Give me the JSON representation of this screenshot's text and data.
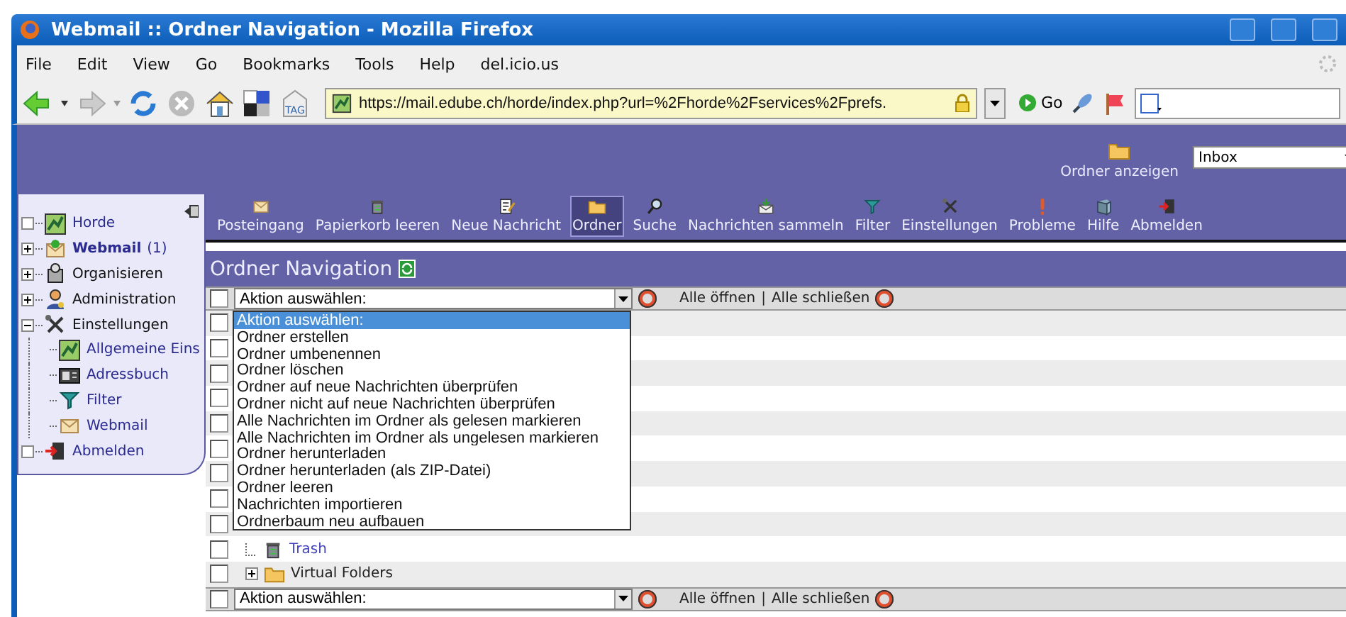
{
  "window": {
    "title": "Webmail :: Ordner Navigation - Mozilla Firefox"
  },
  "menu": [
    "File",
    "Edit",
    "View",
    "Go",
    "Bookmarks",
    "Tools",
    "Help",
    "del.icio.us"
  ],
  "navigation": {
    "url": "https://mail.edube.ch/horde/index.php?url=%2Fhorde%2Fservices%2Fprefs.",
    "tag_label": "TAG",
    "go": "Go"
  },
  "header": {
    "folder_label": "Ordner anzeigen",
    "folder_select": "Inbox"
  },
  "sidebar": {
    "items": [
      {
        "label": "Horde",
        "kind": "horde",
        "link": true
      },
      {
        "label": "Webmail",
        "count": "(1)",
        "kind": "webmail",
        "link": true,
        "bold": true,
        "expanded": false
      },
      {
        "label": "Organisieren",
        "kind": "organize",
        "link": false,
        "expanded": false
      },
      {
        "label": "Administration",
        "kind": "admin",
        "link": false,
        "expanded": false
      },
      {
        "label": "Einstellungen",
        "kind": "tools",
        "link": false,
        "expanded": true,
        "children": [
          {
            "label": "Allgemeine Eins",
            "kind": "horde",
            "link": true
          },
          {
            "label": "Adressbuch",
            "kind": "addressbook",
            "link": true
          },
          {
            "label": "Filter",
            "kind": "filter",
            "link": true
          },
          {
            "label": "Webmail",
            "kind": "mail",
            "link": true
          }
        ]
      },
      {
        "label": "Abmelden",
        "kind": "logout",
        "link": true
      }
    ]
  },
  "toolbar": [
    {
      "label": "Posteingang",
      "kind": "mail",
      "selected": false
    },
    {
      "label": "Papierkorb leeren",
      "kind": "trash",
      "selected": false
    },
    {
      "label": "Neue Nachricht",
      "kind": "compose",
      "selected": false
    },
    {
      "label": "Ordner",
      "kind": "folder",
      "selected": true
    },
    {
      "label": "Suche",
      "kind": "search",
      "selected": false
    },
    {
      "label": "Nachrichten sammeln",
      "kind": "fetch",
      "selected": false
    },
    {
      "label": "Filter",
      "kind": "filter",
      "selected": false
    },
    {
      "label": "Einstellungen",
      "kind": "tools",
      "selected": false
    },
    {
      "label": "Probleme",
      "kind": "alert",
      "selected": false
    },
    {
      "label": "Hilfe",
      "kind": "help",
      "selected": false
    },
    {
      "label": "Abmelden",
      "kind": "logout",
      "selected": false
    }
  ],
  "page": {
    "title": "Ordner Navigation",
    "action_bar_top": {
      "checked": false,
      "select": "Aktion auswählen:",
      "open_all": "Alle öffnen",
      "separator": "|",
      "close_all": "Alle schließen"
    },
    "dropdown": {
      "options": [
        {
          "label": "Aktion auswählen:",
          "selected": true
        },
        {
          "label": "Ordner erstellen",
          "selected": false
        },
        {
          "label": "Ordner umbenennen",
          "selected": false
        },
        {
          "label": "Ordner löschen",
          "selected": false
        },
        {
          "label": "Ordner auf neue Nachrichten überprüfen",
          "selected": false
        },
        {
          "label": "Ordner nicht auf neue Nachrichten überprüfen",
          "selected": false
        },
        {
          "label": "Alle Nachrichten im Ordner als gelesen markieren",
          "selected": false
        },
        {
          "label": "Alle Nachrichten im Ordner als ungelesen markieren",
          "selected": false
        },
        {
          "label": "Ordner herunterladen",
          "selected": false
        },
        {
          "label": "Ordner herunterladen (als ZIP-Datei)",
          "selected": false
        },
        {
          "label": "Ordner leeren",
          "selected": false
        },
        {
          "label": "Nachrichten importieren",
          "selected": false
        },
        {
          "label": "Ordnerbaum neu aufbauen",
          "selected": false
        }
      ]
    },
    "rows": [
      {
        "checked": false
      },
      {
        "checked": false
      },
      {
        "checked": false
      },
      {
        "checked": false
      },
      {
        "checked": false
      },
      {
        "checked": false
      },
      {
        "checked": false
      },
      {
        "checked": false
      },
      {
        "checked": false
      },
      {
        "checked": false,
        "name": "Trash",
        "kind": "trash"
      },
      {
        "checked": false,
        "name": "Virtual Folders",
        "kind": "folder",
        "expanded": false
      }
    ],
    "action_bar_bottom": {
      "checked": false,
      "select": "Aktion auswählen:",
      "open_all": "Alle öffnen",
      "separator": "|",
      "close_all": "Alle schließen"
    }
  }
}
